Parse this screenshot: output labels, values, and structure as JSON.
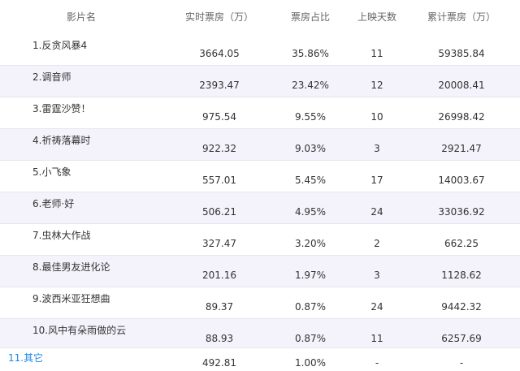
{
  "header": {
    "name": "影片名",
    "realtime": "实时票房（万）",
    "share": "票房占比",
    "days": "上映天数",
    "total": "累计票房（万）"
  },
  "rows": [
    {
      "name": "1.反贪风暴4",
      "realtime": "3664.05",
      "share": "35.86%",
      "days": "11",
      "total": "59385.84"
    },
    {
      "name": "2.调音师",
      "realtime": "2393.47",
      "share": "23.42%",
      "days": "12",
      "total": "20008.41"
    },
    {
      "name": "3.雷霆沙赞！",
      "realtime": "975.54",
      "share": "9.55%",
      "days": "10",
      "total": "26998.42"
    },
    {
      "name": "4.祈祷落幕时",
      "realtime": "922.32",
      "share": "9.03%",
      "days": "3",
      "total": "2921.47"
    },
    {
      "name": "5.小飞象",
      "realtime": "557.01",
      "share": "5.45%",
      "days": "17",
      "total": "14003.67"
    },
    {
      "name": "6.老师·好",
      "realtime": "506.21",
      "share": "4.95%",
      "days": "24",
      "total": "33036.92"
    },
    {
      "name": "7.虫林大作战",
      "realtime": "327.47",
      "share": "3.20%",
      "days": "2",
      "total": "662.25"
    },
    {
      "name": "8.最佳男友进化论",
      "realtime": "201.16",
      "share": "1.97%",
      "days": "3",
      "total": "1128.62"
    },
    {
      "name": "9.波西米亚狂想曲",
      "realtime": "89.37",
      "share": "0.87%",
      "days": "24",
      "total": "9442.32"
    },
    {
      "name": "10.风中有朵雨做的云",
      "realtime": "88.93",
      "share": "0.87%",
      "days": "11",
      "total": "6257.69"
    }
  ],
  "other": {
    "name": "11.其它",
    "realtime": "492.81",
    "share": "1.00%",
    "days": "-",
    "total": "-"
  },
  "colors": {
    "link": "#1e88e5",
    "stripe": "#f4f3fb",
    "border": "#e6e6ee"
  }
}
